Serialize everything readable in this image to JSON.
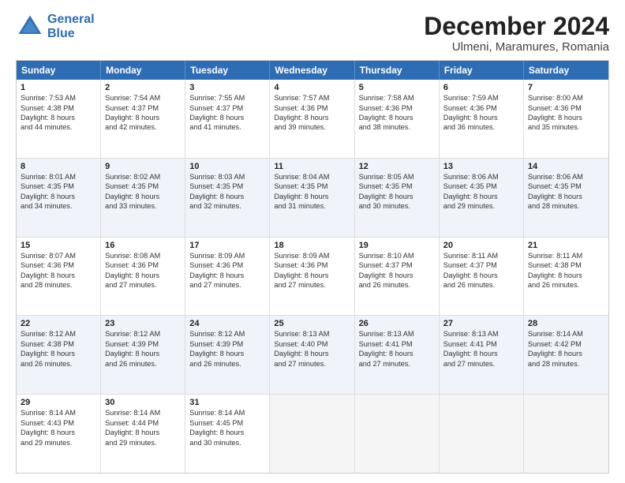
{
  "logo": {
    "line1": "General",
    "line2": "Blue"
  },
  "title": "December 2024",
  "subtitle": "Ulmeni, Maramures, Romania",
  "days": [
    "Sunday",
    "Monday",
    "Tuesday",
    "Wednesday",
    "Thursday",
    "Friday",
    "Saturday"
  ],
  "weeks": [
    [
      {
        "num": "1",
        "lines": [
          "Sunrise: 7:53 AM",
          "Sunset: 4:38 PM",
          "Daylight: 8 hours",
          "and 44 minutes."
        ]
      },
      {
        "num": "2",
        "lines": [
          "Sunrise: 7:54 AM",
          "Sunset: 4:37 PM",
          "Daylight: 8 hours",
          "and 42 minutes."
        ]
      },
      {
        "num": "3",
        "lines": [
          "Sunrise: 7:55 AM",
          "Sunset: 4:37 PM",
          "Daylight: 8 hours",
          "and 41 minutes."
        ]
      },
      {
        "num": "4",
        "lines": [
          "Sunrise: 7:57 AM",
          "Sunset: 4:36 PM",
          "Daylight: 8 hours",
          "and 39 minutes."
        ]
      },
      {
        "num": "5",
        "lines": [
          "Sunrise: 7:58 AM",
          "Sunset: 4:36 PM",
          "Daylight: 8 hours",
          "and 38 minutes."
        ]
      },
      {
        "num": "6",
        "lines": [
          "Sunrise: 7:59 AM",
          "Sunset: 4:36 PM",
          "Daylight: 8 hours",
          "and 36 minutes."
        ]
      },
      {
        "num": "7",
        "lines": [
          "Sunrise: 8:00 AM",
          "Sunset: 4:36 PM",
          "Daylight: 8 hours",
          "and 35 minutes."
        ]
      }
    ],
    [
      {
        "num": "8",
        "lines": [
          "Sunrise: 8:01 AM",
          "Sunset: 4:35 PM",
          "Daylight: 8 hours",
          "and 34 minutes."
        ]
      },
      {
        "num": "9",
        "lines": [
          "Sunrise: 8:02 AM",
          "Sunset: 4:35 PM",
          "Daylight: 8 hours",
          "and 33 minutes."
        ]
      },
      {
        "num": "10",
        "lines": [
          "Sunrise: 8:03 AM",
          "Sunset: 4:35 PM",
          "Daylight: 8 hours",
          "and 32 minutes."
        ]
      },
      {
        "num": "11",
        "lines": [
          "Sunrise: 8:04 AM",
          "Sunset: 4:35 PM",
          "Daylight: 8 hours",
          "and 31 minutes."
        ]
      },
      {
        "num": "12",
        "lines": [
          "Sunrise: 8:05 AM",
          "Sunset: 4:35 PM",
          "Daylight: 8 hours",
          "and 30 minutes."
        ]
      },
      {
        "num": "13",
        "lines": [
          "Sunrise: 8:06 AM",
          "Sunset: 4:35 PM",
          "Daylight: 8 hours",
          "and 29 minutes."
        ]
      },
      {
        "num": "14",
        "lines": [
          "Sunrise: 8:06 AM",
          "Sunset: 4:35 PM",
          "Daylight: 8 hours",
          "and 28 minutes."
        ]
      }
    ],
    [
      {
        "num": "15",
        "lines": [
          "Sunrise: 8:07 AM",
          "Sunset: 4:36 PM",
          "Daylight: 8 hours",
          "and 28 minutes."
        ]
      },
      {
        "num": "16",
        "lines": [
          "Sunrise: 8:08 AM",
          "Sunset: 4:36 PM",
          "Daylight: 8 hours",
          "and 27 minutes."
        ]
      },
      {
        "num": "17",
        "lines": [
          "Sunrise: 8:09 AM",
          "Sunset: 4:36 PM",
          "Daylight: 8 hours",
          "and 27 minutes."
        ]
      },
      {
        "num": "18",
        "lines": [
          "Sunrise: 8:09 AM",
          "Sunset: 4:36 PM",
          "Daylight: 8 hours",
          "and 27 minutes."
        ]
      },
      {
        "num": "19",
        "lines": [
          "Sunrise: 8:10 AM",
          "Sunset: 4:37 PM",
          "Daylight: 8 hours",
          "and 26 minutes."
        ]
      },
      {
        "num": "20",
        "lines": [
          "Sunrise: 8:11 AM",
          "Sunset: 4:37 PM",
          "Daylight: 8 hours",
          "and 26 minutes."
        ]
      },
      {
        "num": "21",
        "lines": [
          "Sunrise: 8:11 AM",
          "Sunset: 4:38 PM",
          "Daylight: 8 hours",
          "and 26 minutes."
        ]
      }
    ],
    [
      {
        "num": "22",
        "lines": [
          "Sunrise: 8:12 AM",
          "Sunset: 4:38 PM",
          "Daylight: 8 hours",
          "and 26 minutes."
        ]
      },
      {
        "num": "23",
        "lines": [
          "Sunrise: 8:12 AM",
          "Sunset: 4:39 PM",
          "Daylight: 8 hours",
          "and 26 minutes."
        ]
      },
      {
        "num": "24",
        "lines": [
          "Sunrise: 8:12 AM",
          "Sunset: 4:39 PM",
          "Daylight: 8 hours",
          "and 26 minutes."
        ]
      },
      {
        "num": "25",
        "lines": [
          "Sunrise: 8:13 AM",
          "Sunset: 4:40 PM",
          "Daylight: 8 hours",
          "and 27 minutes."
        ]
      },
      {
        "num": "26",
        "lines": [
          "Sunrise: 8:13 AM",
          "Sunset: 4:41 PM",
          "Daylight: 8 hours",
          "and 27 minutes."
        ]
      },
      {
        "num": "27",
        "lines": [
          "Sunrise: 8:13 AM",
          "Sunset: 4:41 PM",
          "Daylight: 8 hours",
          "and 27 minutes."
        ]
      },
      {
        "num": "28",
        "lines": [
          "Sunrise: 8:14 AM",
          "Sunset: 4:42 PM",
          "Daylight: 8 hours",
          "and 28 minutes."
        ]
      }
    ],
    [
      {
        "num": "29",
        "lines": [
          "Sunrise: 8:14 AM",
          "Sunset: 4:43 PM",
          "Daylight: 8 hours",
          "and 29 minutes."
        ]
      },
      {
        "num": "30",
        "lines": [
          "Sunrise: 8:14 AM",
          "Sunset: 4:44 PM",
          "Daylight: 8 hours",
          "and 29 minutes."
        ]
      },
      {
        "num": "31",
        "lines": [
          "Sunrise: 8:14 AM",
          "Sunset: 4:45 PM",
          "Daylight: 8 hours",
          "and 30 minutes."
        ]
      },
      null,
      null,
      null,
      null
    ]
  ]
}
